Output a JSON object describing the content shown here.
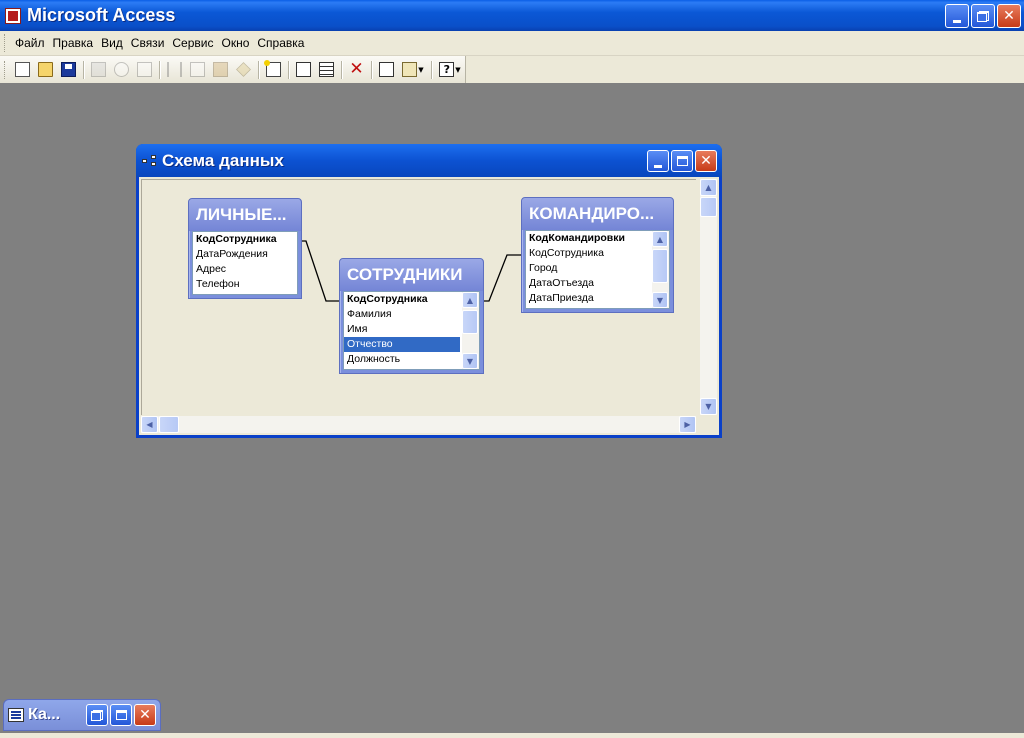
{
  "app": {
    "title": "Microsoft Access"
  },
  "menu": [
    "Файл",
    "Правка",
    "Вид",
    "Связи",
    "Сервис",
    "Окно",
    "Справка"
  ],
  "toolbar": {
    "icons": [
      "new-icon",
      "open-icon",
      "save-icon",
      "print-icon",
      "print-preview-icon",
      "spelling-icon",
      "cut-icon",
      "copy-icon",
      "paste-icon",
      "format-painter-icon",
      "show-table-icon",
      "show-direct-relationships-icon",
      "show-all-relationships-icon",
      "delete-icon",
      "properties-icon",
      "new-object-icon",
      "help-icon"
    ]
  },
  "relationships_window": {
    "title": "Схема данных",
    "tables": [
      {
        "title": "ЛИЧНЫЕ...",
        "fields": [
          {
            "name": "КодСотрудника",
            "key": true
          },
          {
            "name": "ДатаРождения",
            "key": false
          },
          {
            "name": "Адрес",
            "key": false
          },
          {
            "name": "Телефон",
            "key": false
          }
        ]
      },
      {
        "title": "СОТРУДНИКИ",
        "fields": [
          {
            "name": "КодСотрудника",
            "key": true
          },
          {
            "name": "Фамилия",
            "key": false
          },
          {
            "name": "Имя",
            "key": false
          },
          {
            "name": "Отчество",
            "key": false,
            "selected": true
          },
          {
            "name": "Должность",
            "key": false
          }
        ]
      },
      {
        "title": "КОМАНДИРО...",
        "fields": [
          {
            "name": "КодКомандировки",
            "key": true
          },
          {
            "name": "КодСотрудника",
            "key": false
          },
          {
            "name": "Город",
            "key": false
          },
          {
            "name": "ДатаОтъезда",
            "key": false
          },
          {
            "name": "ДатаПриезда",
            "key": false
          }
        ]
      }
    ]
  },
  "minimized_window": {
    "title": "Ка..."
  },
  "colors": {
    "xp_blue": "#0a4fc8",
    "table_header": "#7b8fdc",
    "mdi_background": "#808080",
    "selection": "#316ac5"
  }
}
